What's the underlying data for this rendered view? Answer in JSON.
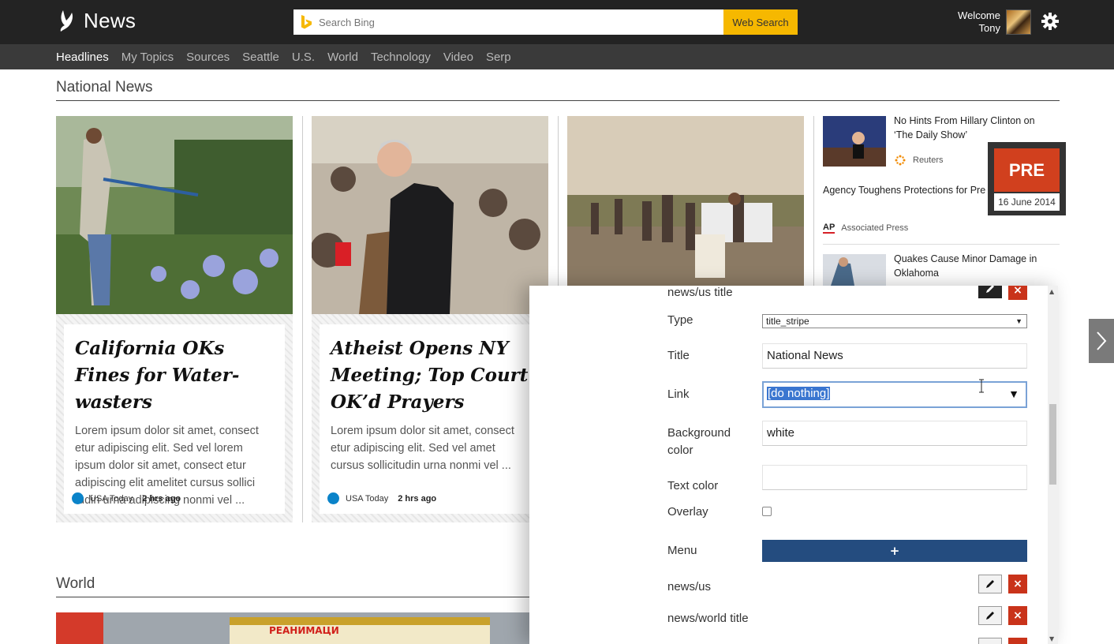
{
  "header": {
    "app_title": "News",
    "search_placeholder": "Search Bing",
    "search_button": "Web Search",
    "welcome_line1": "Welcome",
    "welcome_line2": "Tony"
  },
  "nav": {
    "items": [
      "Headlines",
      "My Topics",
      "Sources",
      "Seattle",
      "U.S.",
      "World",
      "Technology",
      "Video",
      "Serp"
    ],
    "active": "Headlines"
  },
  "sections": {
    "national": "National News",
    "world": "World"
  },
  "cards": [
    {
      "title": "California OKs Fines for Water-wasters",
      "excerpt": "Lorem ipsum dolor sit amet, consect etur adipiscing elit. Sed vel lorem ipsum dolor sit amet, consect etur adipiscing elit amelitet cursus sollici tudin urna adipiscing nonmi vel ...",
      "source": "USA Today",
      "ago": "2 hrs ago"
    },
    {
      "title": "Atheist Opens NY Meeting; Top Court OK’d Prayers",
      "excerpt": "Lorem ipsum dolor sit amet, consect etur adipiscing elit. Sed vel amet cursus  sollicitudin urna nonmi vel ...",
      "source": "USA Today",
      "ago": "2 hrs ago"
    }
  ],
  "sidebar": {
    "story1": {
      "headline": "No Hints From Hillary Clinton on ‘The Daily Show’",
      "source": "Reuters"
    },
    "story2": {
      "headline": "Agency Toughens Protections for Pre",
      "source_logo": "AP",
      "source": "Associated Press"
    },
    "story3": {
      "headline": "Quakes Cause Minor Damage in Oklahoma"
    }
  },
  "pre_badge": {
    "label": "PRE",
    "date": "16 June 2014"
  },
  "editor": {
    "header_label": "news/us title",
    "type_label": "Type",
    "type_value": "title_stripe",
    "title_label": "Title",
    "title_value": "National News",
    "link_label": "Link",
    "link_value": "[do nothing]",
    "bg_label": "Background color",
    "bg_value": "white",
    "text_color_label": "Text color",
    "text_color_value": "",
    "overlay_label": "Overlay",
    "overlay_checked": false,
    "menu_label": "Menu",
    "menu_add": "+",
    "menu_items": [
      "news/us",
      "news/world title"
    ]
  },
  "colors": {
    "topbar": "#232323",
    "navbar": "#3a3a3a",
    "search_button": "#f6b800",
    "delete_button": "#c9331a",
    "menu_button": "#244c7f",
    "pre_badge": "#d1401e"
  }
}
